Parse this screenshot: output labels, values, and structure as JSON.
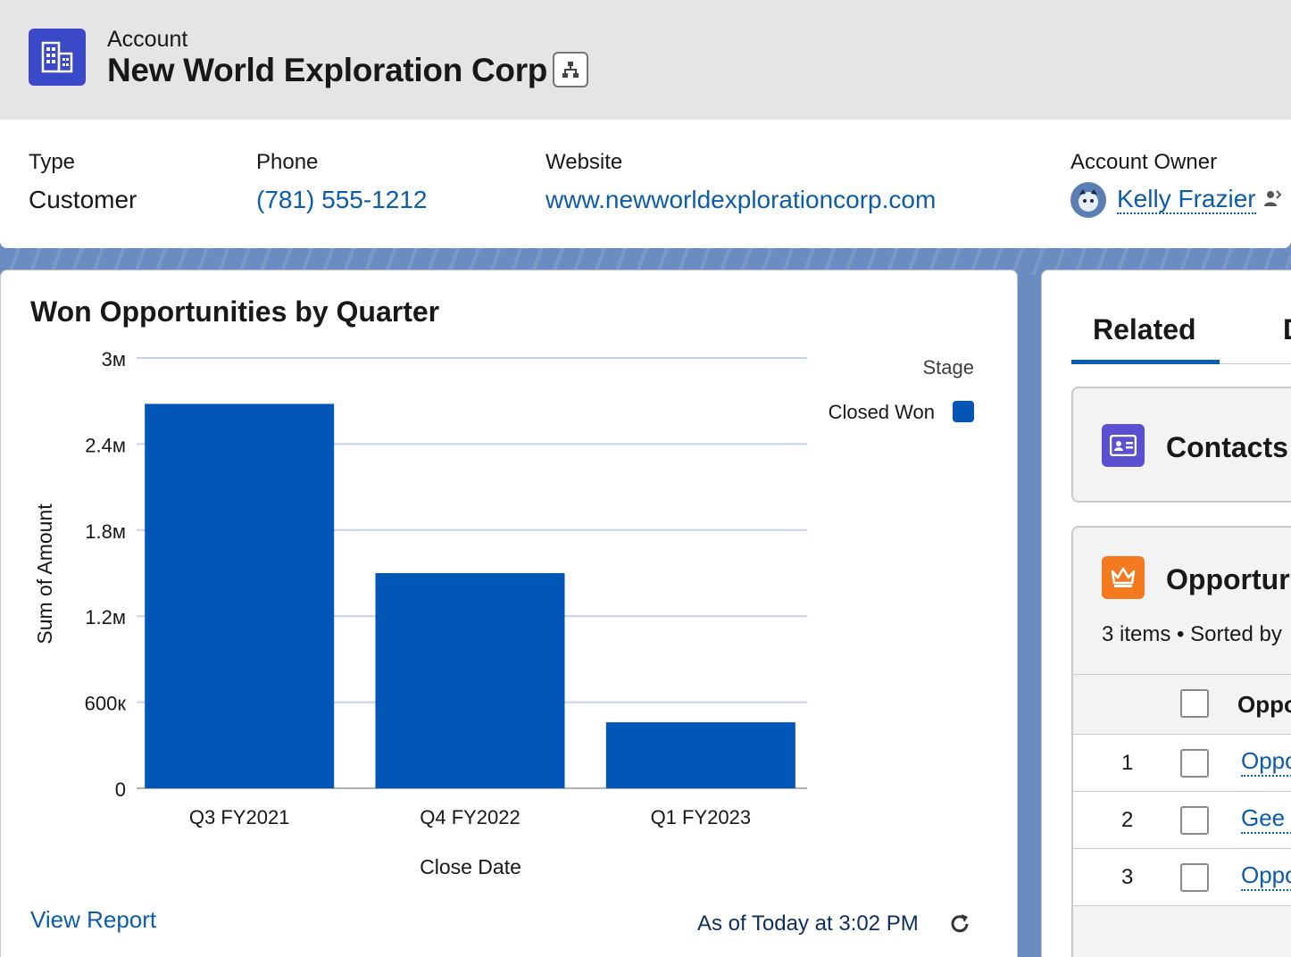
{
  "header": {
    "object_label": "Account",
    "record_name": "New World Exploration Corp"
  },
  "highlights": {
    "type_label": "Type",
    "type_value": "Customer",
    "phone_label": "Phone",
    "phone_value": "(781) 555-1212",
    "website_label": "Website",
    "website_value": "www.newworldexplorationcorp.com",
    "owner_label": "Account Owner",
    "owner_value": "Kelly Frazier"
  },
  "chart_card": {
    "title": "Won Opportunities by Quarter",
    "view_report": "View Report",
    "as_of": "As of Today at 3:02 PM"
  },
  "chart_data": {
    "type": "bar",
    "title": "Won Opportunities by Quarter",
    "xlabel": "Close Date",
    "ylabel": "Sum of Amount",
    "categories": [
      "Q3 FY2021",
      "Q4 FY2022",
      "Q1 FY2023"
    ],
    "series": [
      {
        "name": "Closed Won",
        "values": [
          2680000,
          1500000,
          460000
        ]
      }
    ],
    "ylim": [
      0,
      3000000
    ],
    "yticks": [
      0,
      600000,
      1200000,
      1800000,
      2400000,
      3000000
    ],
    "ytick_labels": [
      "0",
      "600к",
      "1.2м",
      "1.8м",
      "2.4м",
      "3м"
    ],
    "legend_title": "Stage",
    "legend_position": "top-right",
    "grid": true,
    "bar_color": "#0156b8"
  },
  "right_panel": {
    "tab_related": "Related",
    "tab_details_partial": "D",
    "contacts_title": "Contacts",
    "opps_title": "Opportur",
    "opps_meta": "3 items • Sorted by",
    "col_header": "Oppo",
    "rows": [
      {
        "num": "1",
        "label": "Oppo"
      },
      {
        "num": "2",
        "label": "Gee T"
      },
      {
        "num": "3",
        "label": "Oppo"
      }
    ]
  },
  "colors": {
    "account_icon": "#3a49c8",
    "contacts_icon": "#5b4fd2",
    "opportunity_icon": "#f47a1f",
    "link": "#0b5cab",
    "tab_active": "#0b5cab"
  }
}
